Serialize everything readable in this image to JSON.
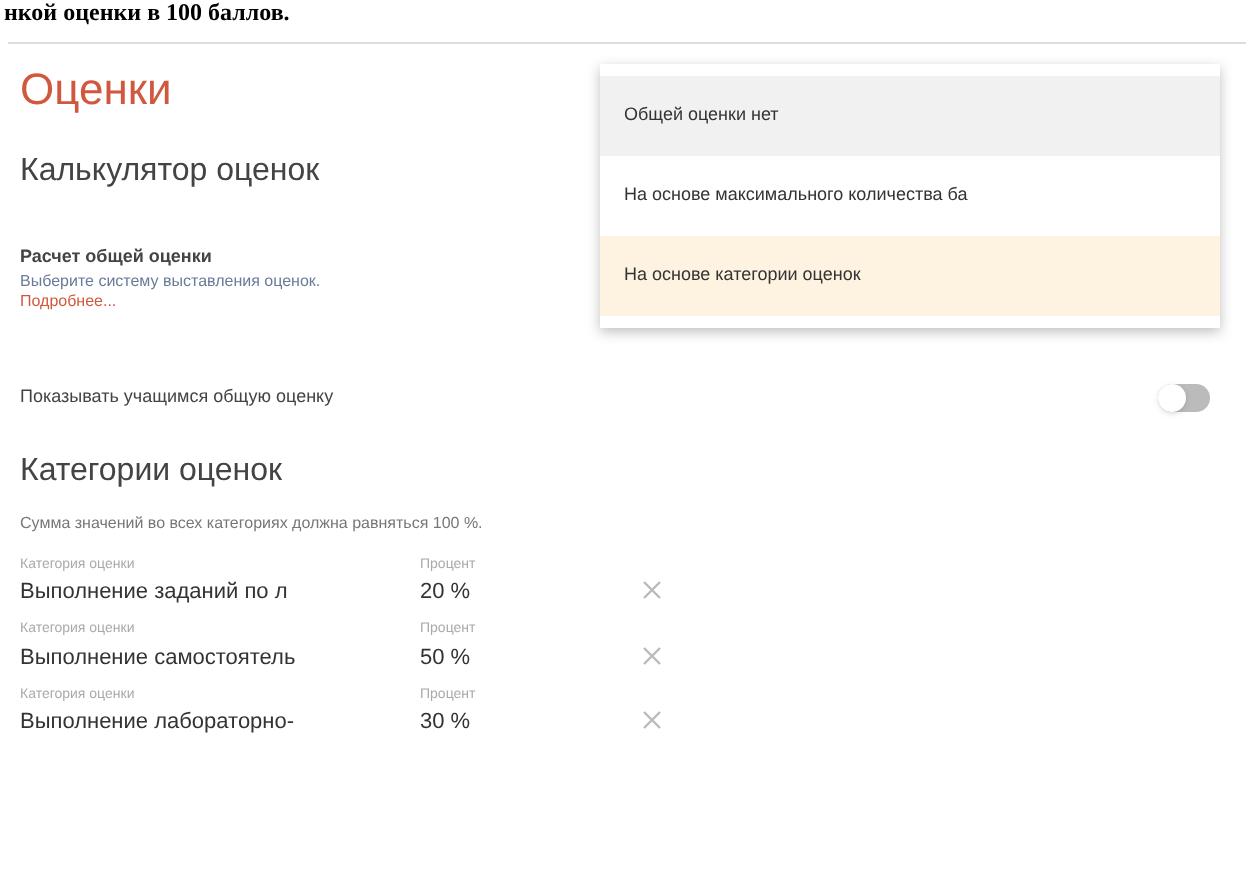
{
  "top_text": "нкой оценки в 100 баллов.",
  "title": "Оценки",
  "calculator": {
    "heading": "Калькулятор оценок",
    "label": "Расчет общей оценки",
    "hint": "Выберите систему выставления оценок.",
    "link": "Подробнее...",
    "options": [
      {
        "label": "Общей оценки нет",
        "selected": false,
        "hovered": true
      },
      {
        "label": "На основе максимального количества ба",
        "selected": false,
        "hovered": false
      },
      {
        "label": "На основе категории оценок",
        "selected": true,
        "hovered": false
      }
    ]
  },
  "show_total": {
    "label": "Показывать учащимся общую оценку",
    "on": false
  },
  "categories": {
    "heading": "Категории оценок",
    "note": "Сумма значений во всех категориях должна равняться 100 %.",
    "rows": [
      {
        "name_label": "Категория оценки",
        "name": "Выполнение заданий по л",
        "percent_label": "Процент",
        "percent": "20 %"
      },
      {
        "name_label": "Категория оценки",
        "name": "Выполнение самостоятель",
        "percent_label": "Процент",
        "percent": "50 %"
      },
      {
        "name_label": "Категория оценки",
        "name": "Выполнение лабораторно-",
        "percent_label": "Процент",
        "percent": "30 %"
      }
    ]
  }
}
